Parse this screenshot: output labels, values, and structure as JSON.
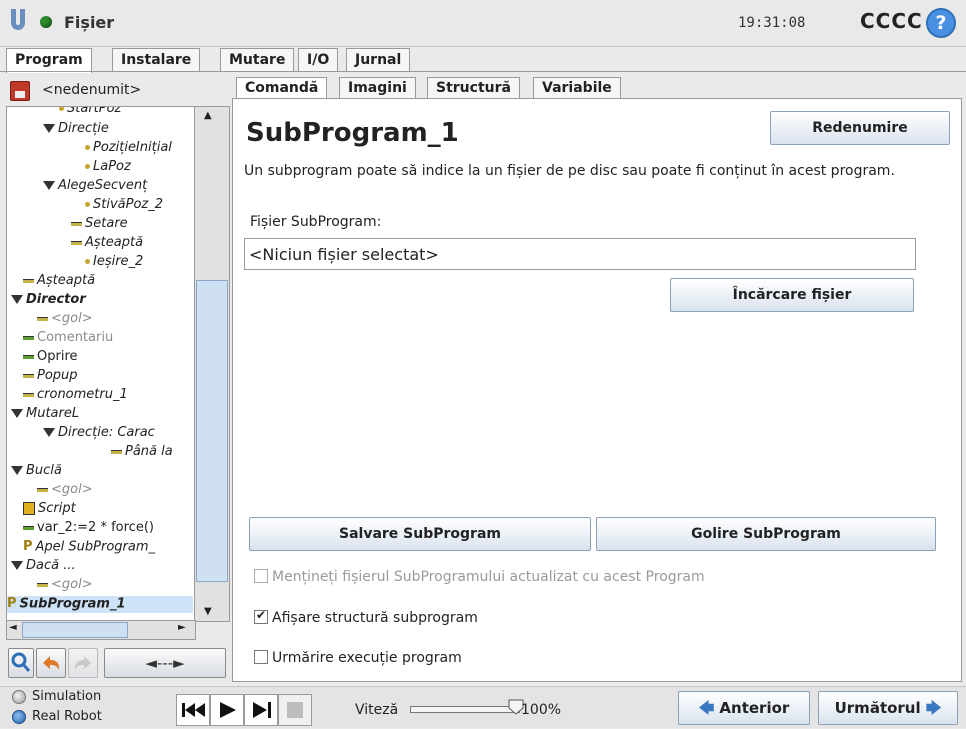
{
  "window": {
    "title": "Fișier",
    "clock": "19:31:08",
    "robot_name": "CCCC",
    "help_label": "?"
  },
  "main_tabs": [
    {
      "label": "Program",
      "active": true
    },
    {
      "label": "Instalare",
      "active": false
    },
    {
      "label": "Mutare",
      "active": false
    },
    {
      "label": "I/O",
      "active": false
    },
    {
      "label": "Jurnal",
      "active": false
    }
  ],
  "left_panel": {
    "program_name": "<nedenumit>",
    "tree": [
      {
        "label": "StartPoz",
        "icon": "dot"
      },
      {
        "label": "Direcție",
        "icon": "triangle"
      },
      {
        "label": "PozițieInițial",
        "icon": "dot"
      },
      {
        "label": "LaPoz",
        "icon": "dot"
      },
      {
        "label": "AlegeSecvenț",
        "icon": "triangle"
      },
      {
        "label": "StivăPoz_2",
        "icon": "dot"
      },
      {
        "label": "Setare",
        "icon": "bar"
      },
      {
        "label": "Așteaptă",
        "icon": "bar"
      },
      {
        "label": "Ieșire_2",
        "icon": "dot"
      },
      {
        "label": "Așteaptă",
        "icon": "bar"
      },
      {
        "label": "Director",
        "icon": "triangle"
      },
      {
        "label": "<gol>",
        "icon": "bar"
      },
      {
        "label": "Comentariu",
        "icon": "bar-green"
      },
      {
        "label": "Oprire",
        "icon": "bar-green"
      },
      {
        "label": "Popup",
        "icon": "bar"
      },
      {
        "label": "cronometru_1",
        "icon": "bar"
      },
      {
        "label": "MutareL",
        "icon": "triangle"
      },
      {
        "label": "Direcție: Carac",
        "icon": "triangle"
      },
      {
        "label": "Până la",
        "icon": "bar"
      },
      {
        "label": "Buclă",
        "icon": "triangle"
      },
      {
        "label": "<gol>",
        "icon": "bar"
      },
      {
        "label": "Script",
        "icon": "script"
      },
      {
        "label": "var_2:=2 * force()",
        "icon": "bar-green"
      },
      {
        "label": "Apel SubProgram_",
        "icon": "p"
      },
      {
        "label": "Dacă ...",
        "icon": "triangle"
      },
      {
        "label": "<gol>",
        "icon": "bar"
      },
      {
        "label": "SubProgram_1",
        "icon": "p"
      }
    ],
    "nav_arrows": "◄---►"
  },
  "sub_tabs": [
    {
      "label": "Comandă",
      "active": true
    },
    {
      "label": "Imagini",
      "active": false
    },
    {
      "label": "Structură",
      "active": false
    },
    {
      "label": "Variabile",
      "active": false
    }
  ],
  "content": {
    "title": "SubProgram_1",
    "rename_button": "Redenumire",
    "description": "Un subprogram poate să indice la un fișier de pe disc sau poate fi conținut în acest program.",
    "file_label": "Fișier SubProgram:",
    "file_value": "<Niciun fișier selectat>",
    "load_button": "Încărcare fișier",
    "save_button": "Salvare SubProgram",
    "clear_button": "Golire SubProgram",
    "checkbox_keep": {
      "label": "Mențineți fișierul SubProgramului actualizat cu acest Program",
      "checked": false,
      "enabled": false
    },
    "checkbox_show": {
      "label": "Afișare structură subprogram",
      "checked": true,
      "enabled": true
    },
    "checkbox_follow": {
      "label": "Urmărire execuție program",
      "checked": false,
      "enabled": true
    }
  },
  "bottom": {
    "mode_sim": "Simulation",
    "mode_real": "Real Robot",
    "speed_label": "Viteză",
    "speed_value": "100%",
    "speed_fraction": 1.0,
    "prev_button": "Anterior",
    "next_button": "Următorul"
  },
  "colors": {
    "accent_blue": "#4a90e2",
    "status_green": "#2d8a2d",
    "save_icon_red": "#c0392b"
  }
}
